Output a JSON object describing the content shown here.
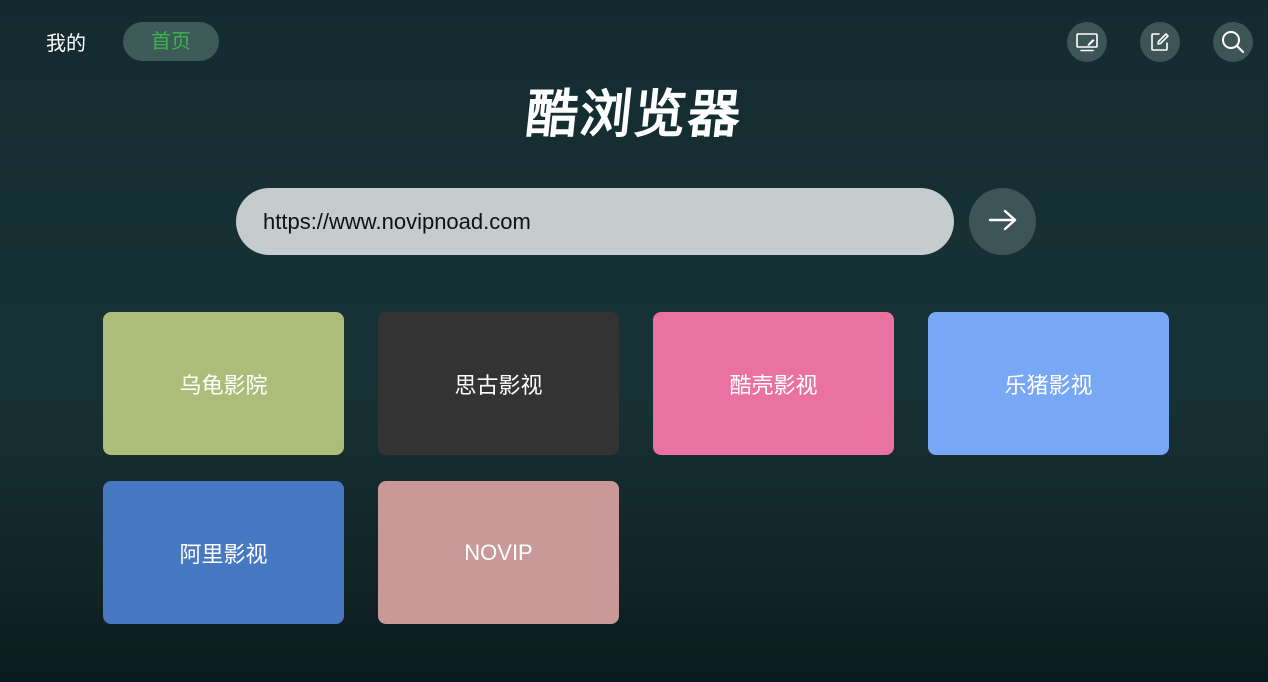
{
  "nav": {
    "mine_label": "我的",
    "home_label": "首页",
    "home_color": "#3bb54a"
  },
  "toolbar": {
    "icons": [
      "screen-icon",
      "edit-icon",
      "search-icon"
    ]
  },
  "title": "酷浏览器",
  "url_bar": {
    "value": "https://www.novipnoad.com",
    "go_icon": "arrow-right-icon"
  },
  "tiles": [
    {
      "label": "乌龟影院",
      "color": "#abbd78"
    },
    {
      "label": "思古影视",
      "color": "#333333"
    },
    {
      "label": "酷壳影视",
      "color": "#ea72a0"
    },
    {
      "label": "乐猪影视",
      "color": "#78a8f5"
    },
    {
      "label": "阿里影视",
      "color": "#4778c2"
    },
    {
      "label": "NOVIP",
      "color": "#c99898"
    }
  ]
}
